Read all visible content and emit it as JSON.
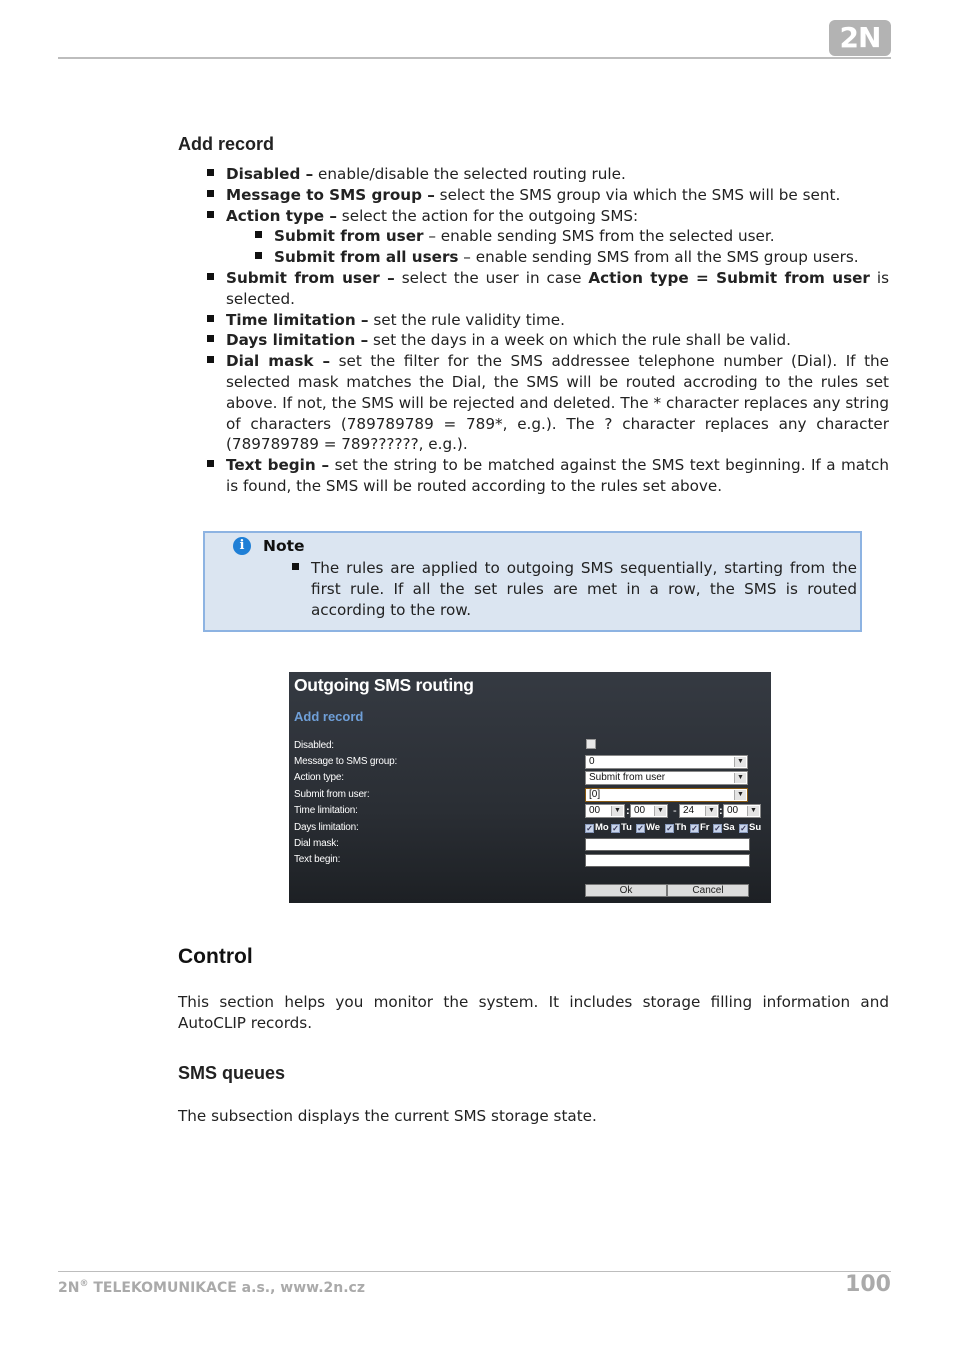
{
  "header": {
    "logo_text": "2N"
  },
  "add_record": {
    "heading": "Add record",
    "items": [
      {
        "term": "Disabled –",
        "desc": " enable/disable the selected routing rule."
      },
      {
        "term": "Message to SMS group –",
        "desc": " select the SMS group via which the SMS will be sent."
      },
      {
        "term": "Action type –",
        "desc": " select the action for the outgoing SMS:"
      },
      {
        "term": "Submit from user –",
        "desc": "  select the user in case ",
        "term2": "Action type = Submit from user",
        "desc2": " is selected."
      },
      {
        "term": "Time limitation –",
        "desc": "  set the rule validity time."
      },
      {
        "term": "Days limitation –",
        "desc": "  set the days in a week on which the rule shall be valid."
      },
      {
        "term": "Dial mask –",
        "desc": "  set the filter for the SMS addressee telephone number (Dial). If the selected mask matches the Dial, the SMS will be routed accroding to the rules set above. If not, the SMS will be rejected and deleted. The * character replaces any string of characters (789789789 = 789*, e.g.). The ? character replaces any character (789789789 = 789??????, e.g.)."
      },
      {
        "term": "Text begin –",
        "desc": "  set the string to be matched against the SMS text beginning. If a match is found, the SMS will be routed according to the rules set above."
      }
    ],
    "sub_items": [
      {
        "term": "Submit from user",
        "desc": " – enable sending SMS from the selected user."
      },
      {
        "term": "Submit from all users",
        "desc": " – enable sending SMS from all the SMS group users."
      }
    ]
  },
  "note": {
    "icon": "info-icon",
    "title": "Note",
    "text": "The rules are applied to outgoing SMS sequentially, starting from the first rule. If all the set rules are met in a row, the SMS is routed according to the row."
  },
  "screenshot": {
    "title": "Outgoing SMS routing",
    "subtitle": "Add record",
    "labels": {
      "disabled": "Disabled:",
      "group": "Message to SMS group:",
      "action": "Action type:",
      "user": "Submit from user:",
      "time": "Time limitation:",
      "days": "Days limitation:",
      "dial": "Dial mask:",
      "text": "Text begin:"
    },
    "values": {
      "disabled_checked": false,
      "group": "0",
      "action": "Submit from user",
      "user": "[0]",
      "time_from_h": "00",
      "time_from_m": "00",
      "time_to_h": "24",
      "time_to_m": "00",
      "dial": "",
      "text": ""
    },
    "separators": {
      "colon": ":",
      "dash": "-"
    },
    "dropdown_arrow": "▼",
    "days": [
      {
        "label": "Mo",
        "checked": true
      },
      {
        "label": "Tu",
        "checked": true
      },
      {
        "label": "We",
        "checked": true
      },
      {
        "label": "Th",
        "checked": true
      },
      {
        "label": "Fr",
        "checked": true
      },
      {
        "label": "Sa",
        "checked": true
      },
      {
        "label": "Su",
        "checked": true
      }
    ],
    "check_mark": "✓",
    "ok_label": "Ok",
    "cancel_label": "Cancel"
  },
  "control": {
    "heading": "Control",
    "text": "This section helps you monitor the system. It includes storage filling information and AutoCLIP records."
  },
  "sms_queues": {
    "heading": "SMS queues",
    "text": "The subsection displays the current SMS storage state."
  },
  "footer": {
    "brand": "2N",
    "reg": "®",
    "company": " TELEKOMUNIKACE a.s., www.2n.cz",
    "page_number": "100"
  }
}
